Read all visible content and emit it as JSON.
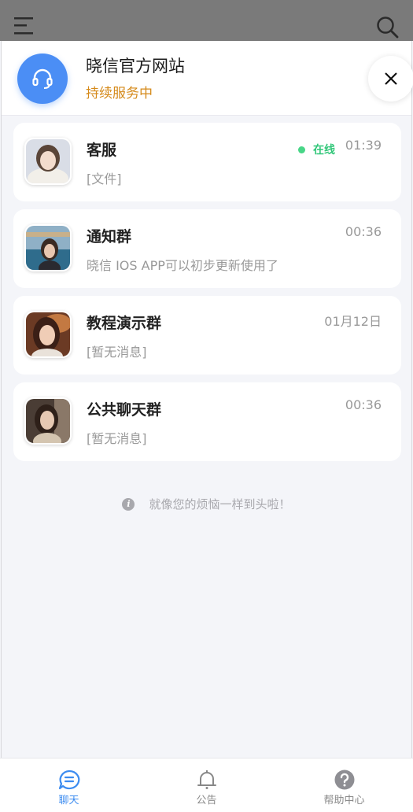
{
  "header": {
    "site_name": "晓信官方网站",
    "status": "持续服务中"
  },
  "chats": [
    {
      "name": "客服",
      "preview": "[文件]",
      "time": "01:39",
      "online_label": "在线"
    },
    {
      "name": "通知群",
      "preview": "晓信 IOS APP可以初步更新使用了",
      "time": "00:36"
    },
    {
      "name": "教程演示群",
      "preview": "[暂无消息]",
      "time": "01月12日"
    },
    {
      "name": "公共聊天群",
      "preview": "[暂无消息]",
      "time": "00:36"
    }
  ],
  "end_note": "就像您的烦恼一样到头啦！",
  "bottom_nav": [
    {
      "label": "聊天",
      "icon": "chat-bubble-icon",
      "active": true
    },
    {
      "label": "公告",
      "icon": "bell-icon",
      "active": false
    },
    {
      "label": "帮助中心",
      "icon": "help-icon",
      "active": false
    }
  ],
  "colors": {
    "accent": "#3d8cf0",
    "status_orange": "#d58a1a",
    "online_green": "#33c77a"
  }
}
